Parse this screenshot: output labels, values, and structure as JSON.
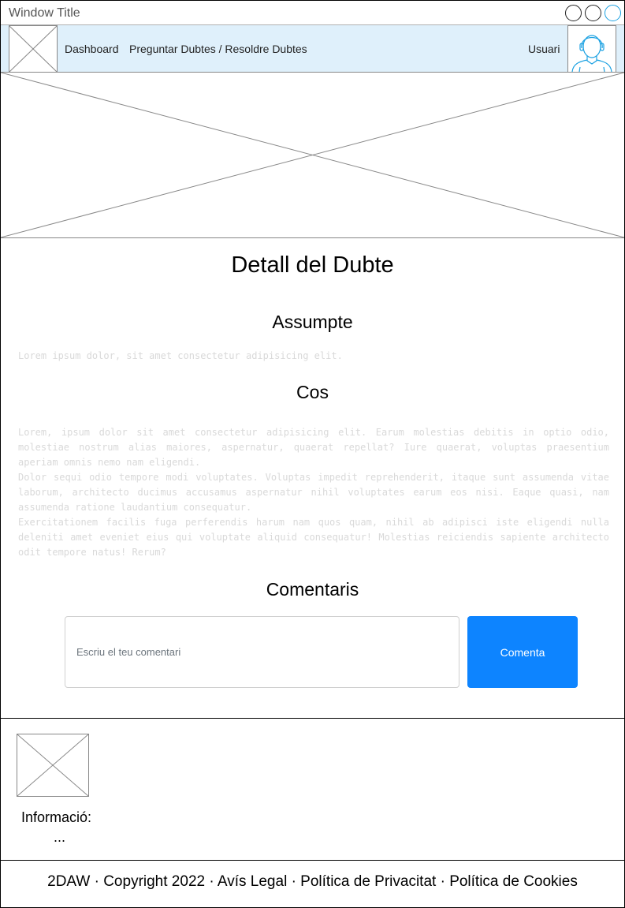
{
  "window": {
    "title": "Window Title"
  },
  "nav": {
    "links": [
      "Dashboard",
      "Preguntar Dubtes / Resoldre Dubtes"
    ],
    "user": "Usuari"
  },
  "main": {
    "title": "Detall del Dubte",
    "subject_heading": "Assumpte",
    "subject_text": "Lorem ipsum dolor, sit amet consectetur adipisicing elit.",
    "body_heading": "Cos",
    "body_paragraphs": [
      "Lorem, ipsum dolor sit amet consectetur adipisicing elit. Earum molestias debitis in optio odio, molestiae nostrum alias maiores, aspernatur, quaerat repellat? Iure quaerat, voluptas praesentium aperiam omnis nemo nam eligendi.",
      "Dolor sequi odio tempore modi voluptates. Voluptas impedit reprehenderit, itaque sunt assumenda vitae laborum, architecto ducimus accusamus aspernatur nihil voluptates earum eos nisi. Eaque quasi, nam assumenda ratione laudantium consequatur.",
      "Exercitationem facilis fuga perferendis harum nam quos quam, nihil ab adipisci iste eligendi nulla deleniti amet eveniet eius qui voluptate aliquid consequatur! Molestias reiciendis sapiente architecto odit tempore natus! Rerum?"
    ],
    "comments_heading": "Comentaris",
    "comment_placeholder": "Escriu el teu comentari",
    "comment_button": "Comenta",
    "accent_color": "#0d84ff"
  },
  "footer": {
    "info_label": "Informació:",
    "info_dots": "...",
    "bottom_text": "2DAW · Copyright 2022 · Avís Legal · Política de Privacitat · Política de Cookies"
  }
}
